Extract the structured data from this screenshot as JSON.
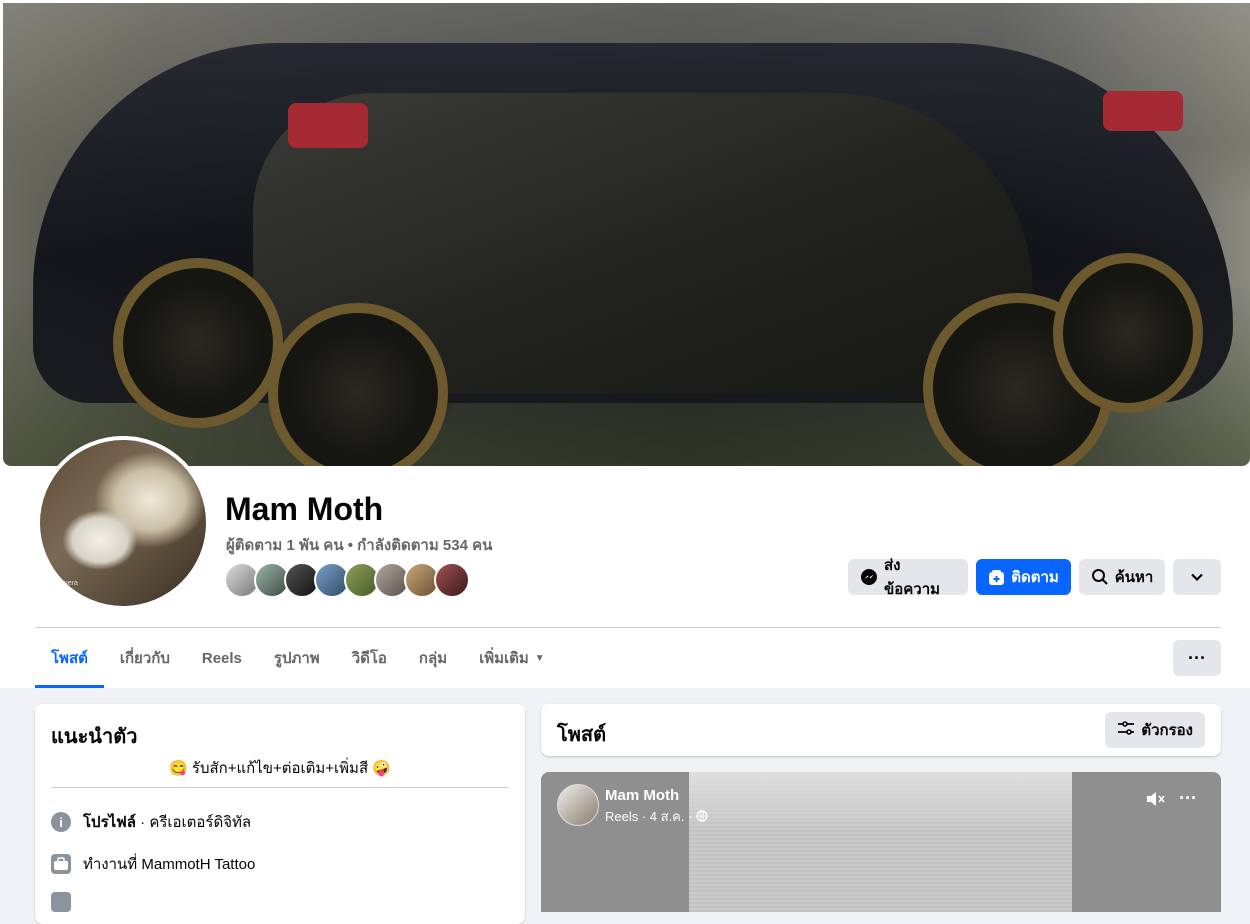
{
  "profile": {
    "name": "Mam Moth",
    "stats": "ผู้ติดตาม 1 พัน คน • กำลังติดตาม 534 คน",
    "avatar_caption": "mera"
  },
  "actions": {
    "message": "ส่งข้อความ",
    "follow": "ติดตาม",
    "search": "ค้นหา"
  },
  "tabs": [
    "โพสต์",
    "เกี่ยวกับ",
    "Reels",
    "รูปภาพ",
    "วิดีโอ",
    "กลุ่ม",
    "เพิ่มเติม"
  ],
  "intro": {
    "title": "แนะนำตัว",
    "bio": "😋 รับสัก+แก้ไข+ต่อเติม+เพิ่มสี 🤪",
    "profile_label": "โปรไฟล์",
    "profile_value": " · ครีเอเตอร์ดิจิทัล",
    "work_prefix": "ทำงานที่ ",
    "work_value": "MammotH Tattoo"
  },
  "posts": {
    "title": "โพสต์",
    "filter": "ตัวกรอง"
  },
  "reel": {
    "author": "Mam Moth",
    "meta": "Reels · 4 ส.ค. ·"
  },
  "colors": {
    "accent": "#0866ff",
    "secondary_text": "#65676b",
    "button_gray": "#e4e6eb",
    "page_bg": "#f0f2f5"
  }
}
